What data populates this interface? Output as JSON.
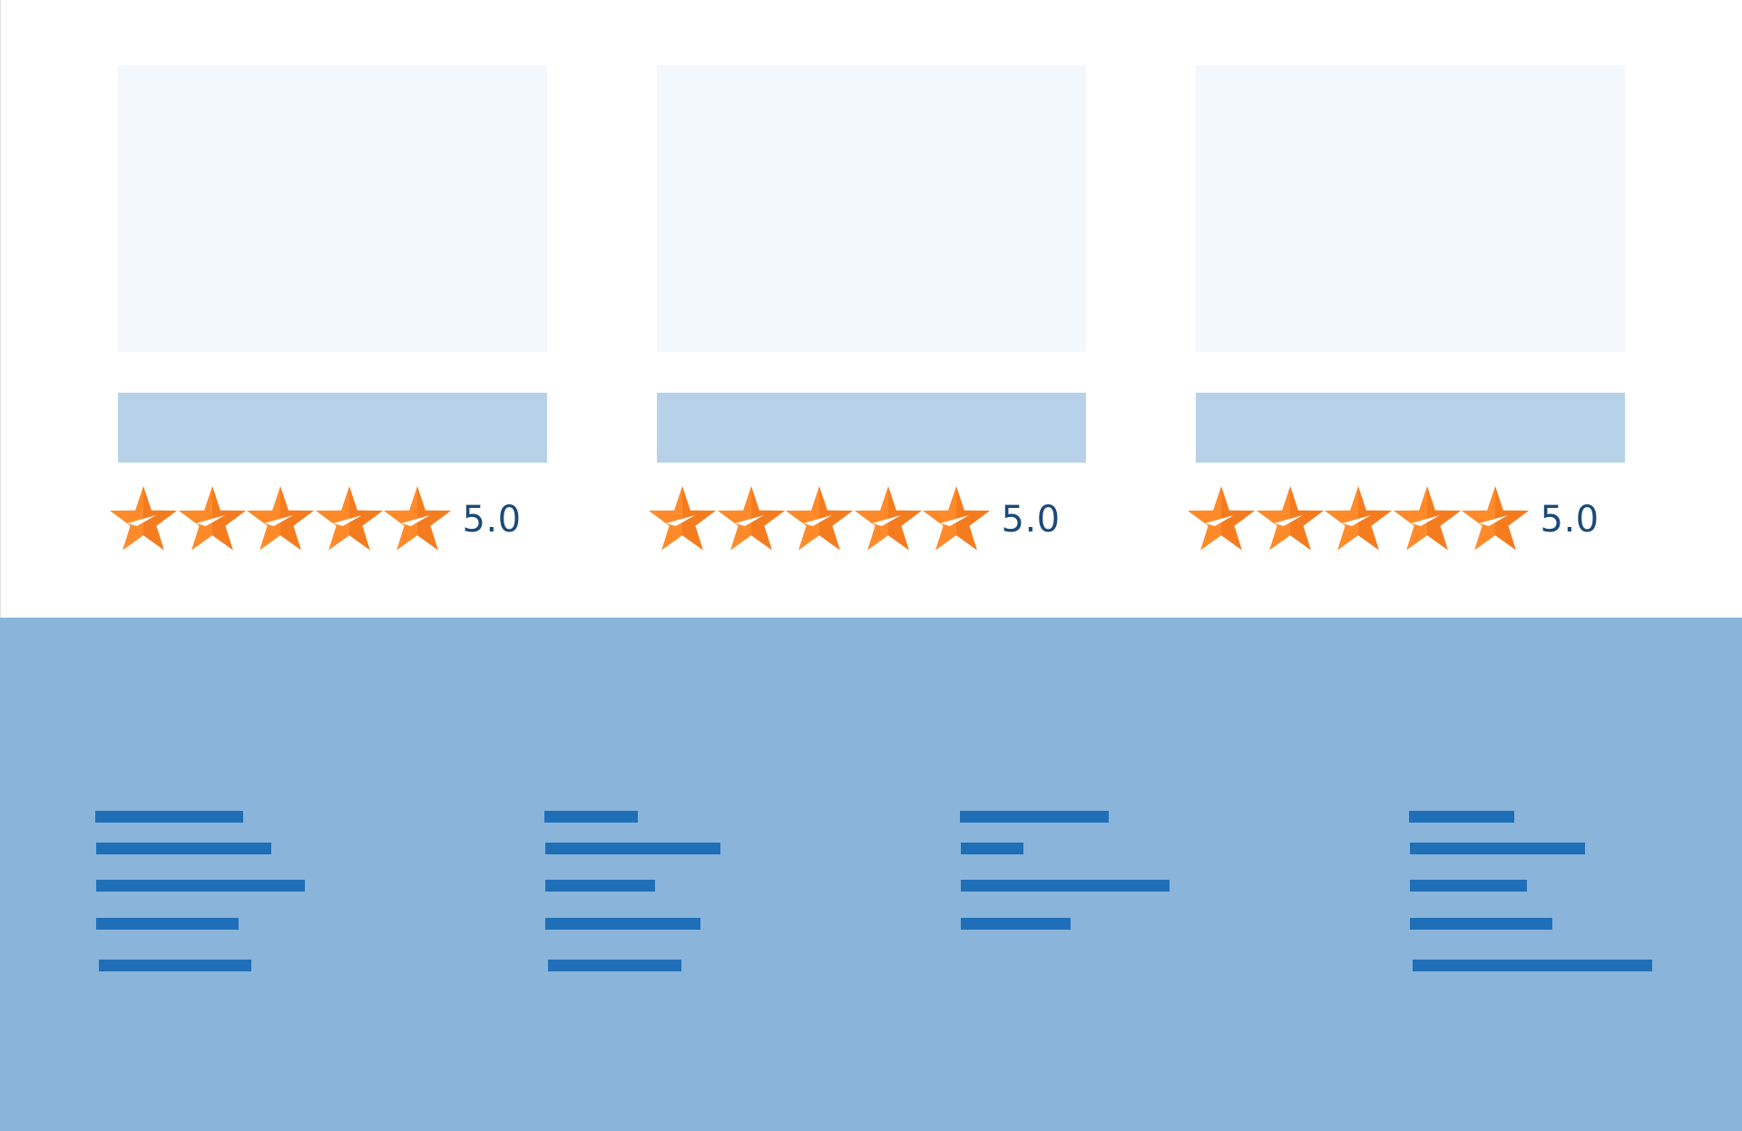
{
  "colors": {
    "page_background": "#ffffff",
    "image_placeholder": "#f2f8fc",
    "title_placeholder": "#b6d1e8",
    "star_fill": "#ff8a2a",
    "star_shade": "#e35f0b",
    "rating_text": "#1b4a7a",
    "footer_background": "#8ab4da",
    "footer_link_placeholder": "#1f6fb8"
  },
  "cards": [
    {
      "rating": {
        "stars": 5,
        "max": 5,
        "value_label": "5.0"
      }
    },
    {
      "rating": {
        "stars": 5,
        "max": 5,
        "value_label": "5.0"
      }
    },
    {
      "rating": {
        "stars": 5,
        "max": 5,
        "value_label": "5.0"
      }
    }
  ]
}
